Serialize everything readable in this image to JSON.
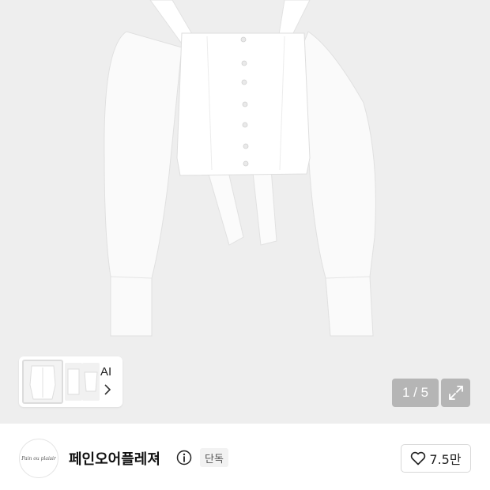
{
  "gallery": {
    "thumbnails_more_label": "AI",
    "page_counter": "1 / 5",
    "current_page": 1,
    "total_pages": 5
  },
  "brand": {
    "logo_text": "Pain ou plaisir",
    "name": "페인오어플레져",
    "badge": "단독"
  },
  "like": {
    "count": "7.5만"
  },
  "icons": [
    "chevron-right-icon",
    "expand-icon",
    "info-icon",
    "heart-icon"
  ]
}
